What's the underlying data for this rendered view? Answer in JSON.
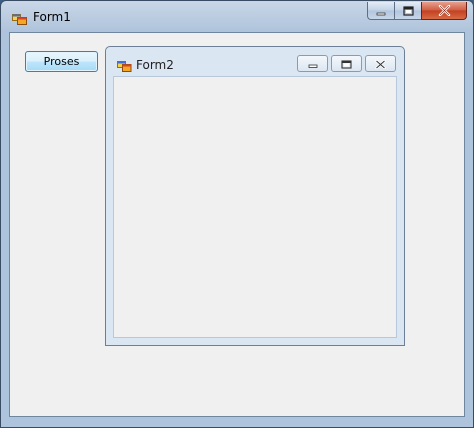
{
  "form1": {
    "title": "Form1",
    "icon": "app-window-icon",
    "caption_buttons": [
      "minimize-icon",
      "maximize-icon",
      "close-icon"
    ],
    "button": {
      "label": "Proses"
    }
  },
  "form2": {
    "title": "Form2",
    "icon": "app-window-icon",
    "caption_buttons": [
      "minimize-icon",
      "restore-icon",
      "close-icon"
    ]
  },
  "colors": {
    "client_bg": "#f0f0f0",
    "titlebar": "#b8cadf",
    "close_button": "#c2401f"
  }
}
